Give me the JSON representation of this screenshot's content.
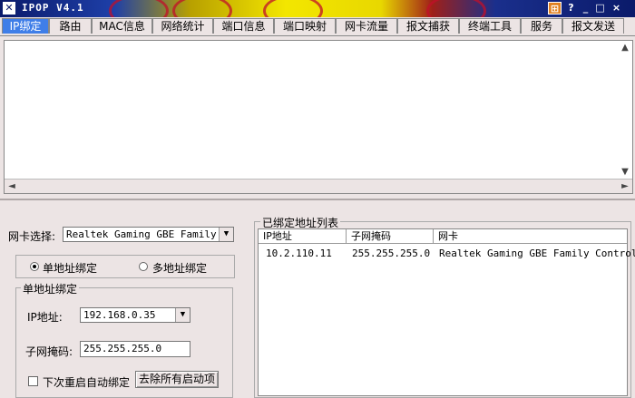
{
  "window": {
    "title": "IPOP V4.1",
    "controls": [
      "?",
      "_",
      "□",
      "×"
    ]
  },
  "tabs": [
    "IP绑定",
    "路由",
    "MAC信息",
    "网络统计",
    "端口信息",
    "端口映射",
    "网卡流量",
    "报文捕获",
    "终端工具",
    "服务",
    "报文发送"
  ],
  "active_tab": "IP绑定",
  "nic": {
    "label": "网卡选择:",
    "value": "Realtek Gaming GBE Family Co:"
  },
  "mode": {
    "single_label": "单地址绑定",
    "multi_label": "多地址绑定",
    "selected": "单地址绑定"
  },
  "single": {
    "group_title": "单地址绑定",
    "ip_label": "IP地址:",
    "ip_value": "192.168.0.35",
    "mask_label": "子网掩码:",
    "mask_value": "255.255.255.0",
    "reboot_label": "下次重启自动绑定",
    "reboot_checked": false,
    "clear_button": "去除所有启动项"
  },
  "bound": {
    "group_title": "已绑定地址列表",
    "columns": [
      "IP地址",
      "子网掩码",
      "网卡"
    ],
    "rows": [
      [
        "10.2.110.11",
        "255.255.255.0",
        "Realtek Gaming GBE Family Controlle"
      ]
    ]
  },
  "scroll": {
    "up": "▲",
    "down": "▼",
    "left": "◄",
    "right": "►",
    "dropdown": "▼"
  }
}
